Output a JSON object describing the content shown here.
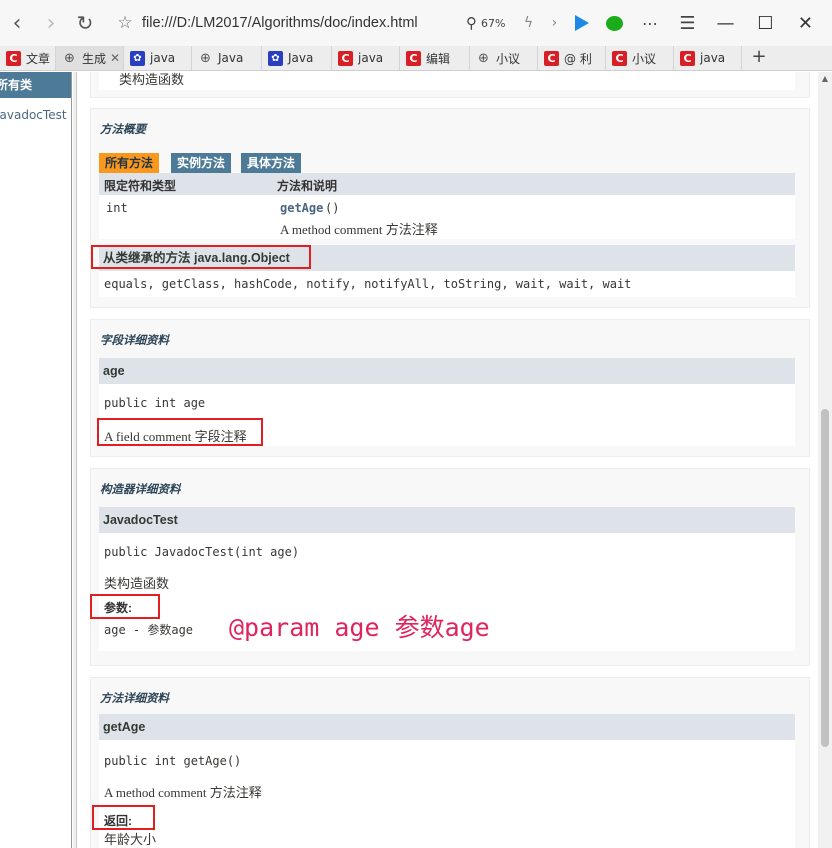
{
  "toolbar": {
    "back_icon": "‹",
    "forward_icon": "›",
    "reload_icon": "↻",
    "star_icon": "☆",
    "url": "file:///D:/LM2017/Algorithms/doc/index.html",
    "zoom": "67%",
    "more_icon": "⋯",
    "menu_icon": "☰",
    "minimize_icon": "—",
    "maximize_icon": "☐",
    "close_icon": "✕"
  },
  "tabs": [
    {
      "label": "文章",
      "icon": "c"
    },
    {
      "label": "生成",
      "icon": "globe",
      "active": true
    },
    {
      "label": "java",
      "icon": "paw"
    },
    {
      "label": "Java",
      "icon": "globe"
    },
    {
      "label": "Java",
      "icon": "paw"
    },
    {
      "label": "java",
      "icon": "c"
    },
    {
      "label": "编辑",
      "icon": "c"
    },
    {
      "label": "小议",
      "icon": "globe"
    },
    {
      "label": "@ 利",
      "icon": "c"
    },
    {
      "label": "小议",
      "icon": "c"
    },
    {
      "label": "java",
      "icon": "c"
    }
  ],
  "tab_add": "+",
  "sidebar": {
    "header": "所有类",
    "class_item": "JavadocTest"
  },
  "content": {
    "constructor_summary_desc": "类构造函数",
    "method_summary": {
      "title": "方法概要",
      "tabs": [
        "所有方法",
        "实例方法",
        "具体方法"
      ],
      "col_modifier": "限定符和类型",
      "col_method": "方法和说明",
      "row_type": "int",
      "row_method": "getAge",
      "row_parens": "()",
      "row_desc": "A method comment 方法注释",
      "inherited_label": "从类继承的方法 java.lang.Object",
      "inherited_methods": "equals, getClass, hashCode, notify, notifyAll, toString, wait, wait, wait"
    },
    "field_detail": {
      "title": "字段详细资料",
      "name": "age",
      "signature": "public int age",
      "comment": "A field comment 字段注释"
    },
    "constructor_detail": {
      "title": "构造器详细资料",
      "name": "JavadocTest",
      "signature": "public JavadocTest(int age)",
      "desc": "类构造函数",
      "params_label": "参数:",
      "param": "age - 参数age"
    },
    "annotation": "@param age 参数age",
    "method_detail": {
      "title": "方法详细资料",
      "name": "getAge",
      "signature": "public int getAge()",
      "desc": "A method comment 方法注释",
      "returns_label": "返回:",
      "returns": "年龄大小"
    }
  },
  "colors": {
    "accent_red": "#e02020",
    "javadoc_blue": "#4d7a97",
    "tab_orange": "#f8981d",
    "annotation_pink": "#e0245e"
  }
}
